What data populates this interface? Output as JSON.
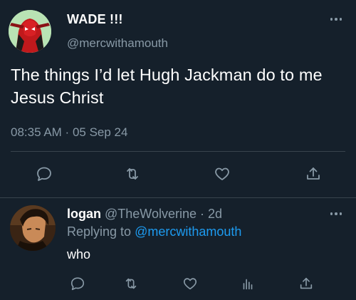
{
  "tweet": {
    "display_name": "WADE !!!",
    "handle": "@mercwithamouth",
    "text": "The things I’d let Hugh Jackman do to me Jesus Christ",
    "time": "08:35 AM",
    "separator": " · ",
    "date": "05 Sep 24",
    "actions": [
      "reply-icon",
      "retweet-icon",
      "like-icon",
      "share-icon"
    ]
  },
  "reply": {
    "display_name": "logan",
    "handle": "@TheWolverine",
    "separator": " · ",
    "time": "2d",
    "replying_prefix": "Replying to ",
    "replying_to": "@mercwithamouth",
    "text": "who",
    "actions": [
      "reply-icon",
      "retweet-icon",
      "like-icon",
      "analytics-icon",
      "share-icon"
    ]
  },
  "colors": {
    "background": "#15202b",
    "text": "#ffffff",
    "secondary": "#8899a6",
    "accent": "#1d9bf0",
    "divider": "#38444d"
  }
}
